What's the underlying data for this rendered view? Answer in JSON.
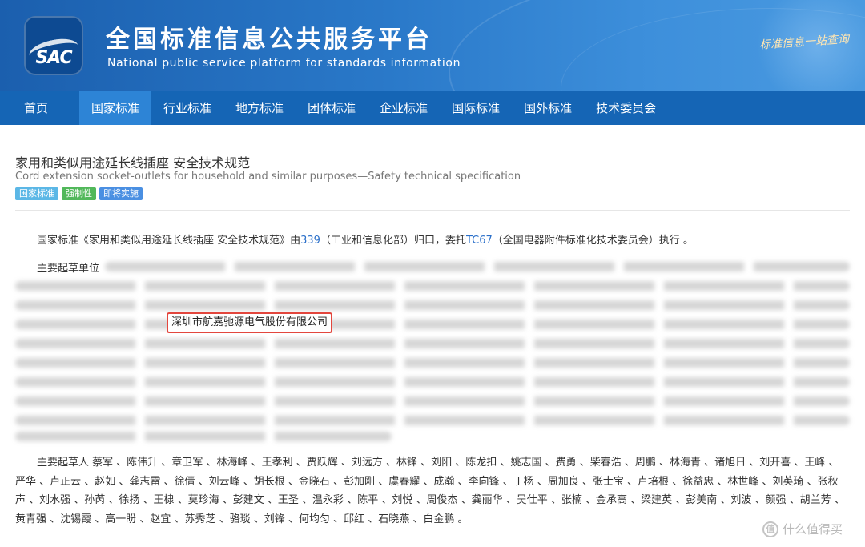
{
  "header": {
    "logo_text": "SAC",
    "title": "全国标准信息公共服务平台",
    "subtitle": "National public service platform  for standards information",
    "slogan": "标准信息一站查询"
  },
  "nav": {
    "items": [
      "首页",
      "国家标准",
      "行业标准",
      "地方标准",
      "团体标准",
      "企业标准",
      "国际标准",
      "国外标准",
      "技术委员会"
    ],
    "active": "国家标准"
  },
  "standard": {
    "title": "家用和类似用途延长线插座 安全技术规范",
    "title_en": "Cord extension socket-outlets for household and similar purposes—Safety technical specification",
    "tags": [
      "国家标准",
      "强制性",
      "即将实施"
    ],
    "intro": {
      "prefix": "国家标准《家用和类似用途延长线插座 安全技术规范》由",
      "org_code": "339",
      "org_text": "（工业和信息化部）归口，委托",
      "tc_code": "TC67",
      "tc_text": "（全国电器附件标准化技术委员会）执行 。"
    },
    "drafting_units_label": "主要起草单位",
    "highlighted_unit": "深圳市航嘉驰源电气股份有限公司",
    "drafters": "主要起草人 蔡军 、陈伟升 、章卫军 、林海峰 、王孝利 、贾跃辉 、刘远方 、林锋 、刘阳 、陈龙扣 、姚志国 、费勇 、柴春浩 、周鹏 、林海青 、诸旭日 、刘开喜 、王峰 、严华 、卢正云 、赵如 、龚志雷 、徐倩 、刘云峰 、胡长根 、金晓石 、彭加刚 、虞春耀 、成瀚 、李向锋 、丁杨 、周加良 、张士宝 、卢培根 、徐益忠 、林世峰 、刘英琦 、张秋声 、刘水强 、孙芮 、徐扬 、王棣 、莫珍海 、彭建文 、王圣 、温永彩 、陈平 、刘悦 、周俊杰 、龚丽华 、吴仕平 、张楠 、金承高 、梁建英 、彭美南 、刘波 、颜强 、胡兰芳 、黄青强 、沈锡霞 、高一盼 、赵宜 、苏秀芝 、骆琰 、刘锋 、何均匀 、邱红 、石晓燕 、白金鹏 。"
  },
  "watermark": {
    "icon": "值",
    "text": "什么值得买"
  },
  "colors": {
    "nav_bg": "#1565b5",
    "nav_active": "#2d84d6",
    "link": "#2a6fc9",
    "highlight_border": "#e3463d"
  }
}
